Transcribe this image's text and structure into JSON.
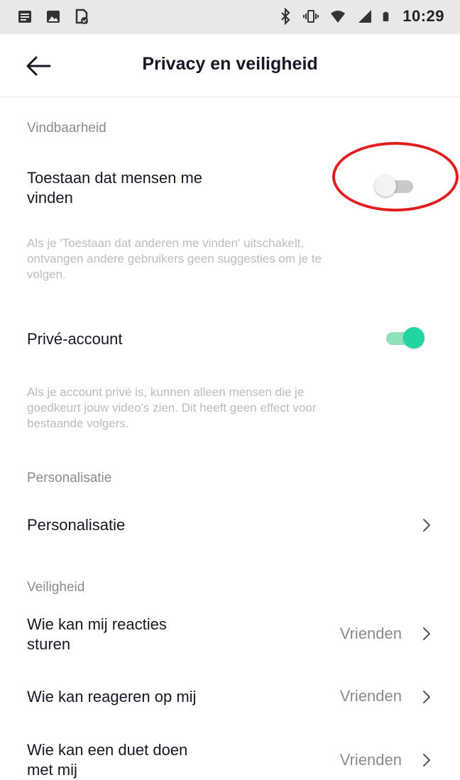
{
  "status_bar": {
    "left_icons": [
      "notes-icon",
      "image-icon",
      "doc-check-icon"
    ],
    "right_icons": [
      "bluetooth-icon",
      "vibrate-icon",
      "wifi-icon",
      "signal-icon",
      "battery-icon"
    ],
    "time": "10:29"
  },
  "header": {
    "title": "Privacy en veiligheid",
    "back_icon": "arrow-left-icon"
  },
  "sections": {
    "findability": {
      "label": "Vindbaarheid",
      "allow_find": {
        "title_line1": "Toestaan dat mensen me",
        "title_line2": "vinden",
        "enabled": false,
        "description_line1": "Als je 'Toestaan dat anderen me vinden' uitschakelt,",
        "description_line2": "ontvangen andere gebruikers geen suggesties om je te",
        "description_line3": "volgen."
      },
      "private_account": {
        "title": "Privé-account",
        "enabled": true,
        "description_line1": "Als je account privé is, kunnen alleen mensen die je",
        "description_line2": "goedkeurt jouw video's zien. Dit heeft geen effect voor",
        "description_line3": "bestaande volgers."
      }
    },
    "personalization": {
      "label": "Personalisatie",
      "item_title": "Personalisatie"
    },
    "safety": {
      "label": "Veiligheid",
      "items": [
        {
          "title_line1": "Wie kan mij reacties",
          "title_line2": "sturen",
          "value": "Vrienden"
        },
        {
          "title_line1": "Wie kan reageren op mij",
          "title_line2": "",
          "value": "Vrienden"
        },
        {
          "title_line1": "Wie kan een duet doen",
          "title_line2": "met mij",
          "value": "Vrienden"
        }
      ]
    }
  },
  "colors": {
    "accent_toggle_on": "#20d5a2",
    "highlight_annotation": "#e01e1e"
  }
}
